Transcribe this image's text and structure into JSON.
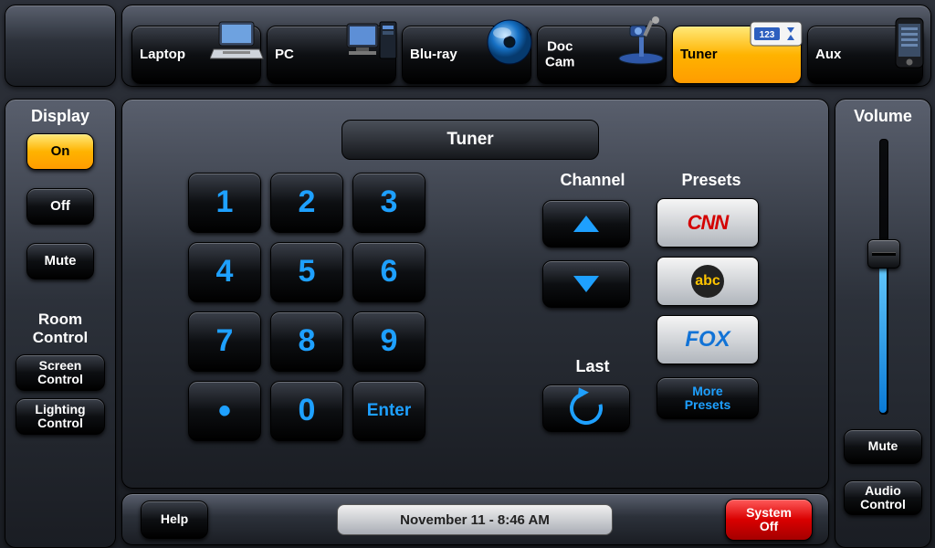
{
  "sources": [
    {
      "label": "Laptop",
      "icon": "laptop",
      "sel": false
    },
    {
      "label": "PC",
      "icon": "pc",
      "sel": false
    },
    {
      "label": "Blu-ray",
      "icon": "disc",
      "sel": false
    },
    {
      "label": "Doc\nCam",
      "icon": "doccam",
      "sel": false
    },
    {
      "label": "Tuner",
      "icon": "tuner",
      "sel": true
    },
    {
      "label": "Aux",
      "icon": "phone",
      "sel": false
    }
  ],
  "left": {
    "display_label": "Display",
    "on": "On",
    "off": "Off",
    "mute": "Mute",
    "room_label": "Room\nControl",
    "screen": "Screen\nControl",
    "lighting": "Lighting\nControl"
  },
  "center": {
    "title": "Tuner",
    "keypad": [
      "1",
      "2",
      "3",
      "4",
      "5",
      "6",
      "7",
      "8",
      "9",
      "•",
      "0",
      "Enter"
    ],
    "channel_label": "Channel",
    "last_label": "Last",
    "presets_label": "Presets",
    "presets": [
      {
        "name": "CNN",
        "color": "#d40000"
      },
      {
        "name": "abc",
        "color": "#ffc400"
      },
      {
        "name": "FOX",
        "color": "#1273d6"
      }
    ],
    "more_presets": "More\nPresets"
  },
  "right": {
    "volume_label": "Volume",
    "mute": "Mute",
    "audio": "Audio\nControl"
  },
  "bottom": {
    "help": "Help",
    "datetime": "November 11  -  8:46 AM",
    "sysoff": "System\nOff"
  }
}
